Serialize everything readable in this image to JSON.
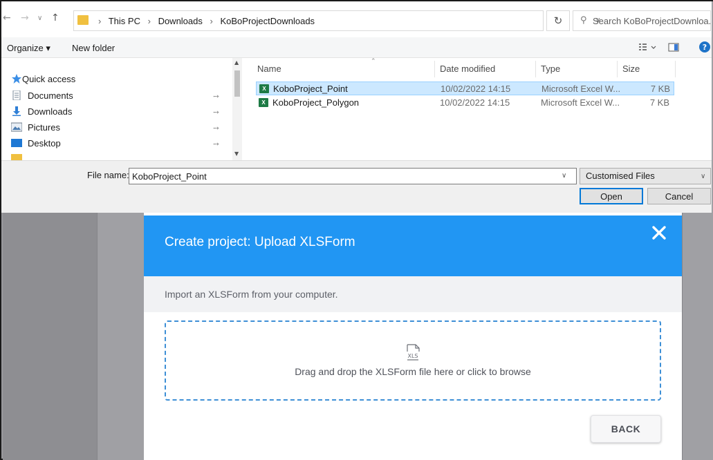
{
  "dialog": {
    "address": {
      "crumbs": [
        "This PC",
        "Downloads",
        "KoBoProjectDownloads"
      ],
      "search_placeholder": "Search KoBoProjectDownloa..."
    },
    "toolbar": {
      "organize_label": "Organize ▾",
      "new_folder_label": "New folder"
    },
    "nav_pane": {
      "items": [
        {
          "label": "Quick access",
          "icon": "star-icon"
        },
        {
          "label": "Documents",
          "icon": "documents-icon"
        },
        {
          "label": "Downloads",
          "icon": "downloads-icon"
        },
        {
          "label": "Pictures",
          "icon": "pictures-icon"
        },
        {
          "label": "Desktop",
          "icon": "desktop-icon"
        }
      ]
    },
    "file_list": {
      "columns": [
        "Name",
        "Date modified",
        "Type",
        "Size"
      ],
      "rows": [
        {
          "name": "KoboProject_Point",
          "date": "10/02/2022 14:15",
          "type": "Microsoft Excel W...",
          "size": "7 KB",
          "selected": true
        },
        {
          "name": "KoboProject_Polygon",
          "date": "10/02/2022 14:15",
          "type": "Microsoft Excel W...",
          "size": "7 KB",
          "selected": false
        }
      ]
    },
    "bottom": {
      "file_name_label": "File name:",
      "file_name_value": "KoboProject_Point",
      "filter_value": "Customised Files",
      "open_label": "Open",
      "cancel_label": "Cancel"
    }
  },
  "modal": {
    "title": "Create project: Upload XLSForm",
    "subtitle": "Import an XLSForm from your computer.",
    "dropzone_icon_text": "XLS",
    "dropzone_text": "Drag and drop the XLSForm file here or click to browse",
    "back_label": "BACK"
  },
  "colors": {
    "header_blue": "#2196f3",
    "dropzone_border": "#3d8fd6",
    "selection": "#cce8ff",
    "excel_green": "#1d7a45"
  }
}
